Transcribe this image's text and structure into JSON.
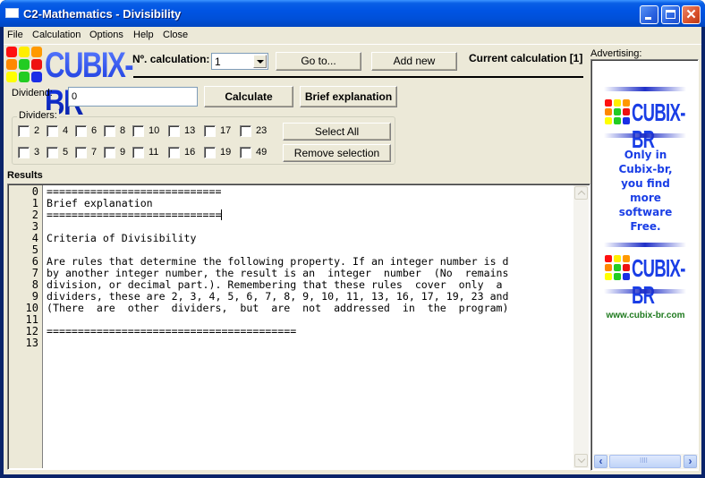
{
  "window": {
    "title": "C2-Mathematics - Divisibility",
    "controls": {
      "minimize": "minimize",
      "maximize": "maximize",
      "close": "✕"
    }
  },
  "menu": [
    "File",
    "Calculation",
    "Options",
    "Help",
    "Close"
  ],
  "logo": {
    "text": "CUBIX-BR",
    "colors": [
      "#ff1010",
      "#ffee00",
      "#ff9900",
      "#ff8800",
      "#22cc22",
      "#ee1111",
      "#ffff00",
      "#22cc22",
      "#1a2ee6"
    ]
  },
  "toolbar": {
    "calc_number_label": "Nº. calculation:",
    "calc_number_value": "1",
    "goto_label": "Go to...",
    "add_new_label": "Add new",
    "current_calc_label": "Current calculation [1]"
  },
  "dividend": {
    "label": "Dividend:",
    "value": "0"
  },
  "actions": {
    "calculate": "Calculate",
    "brief_explanation": "Brief explanation"
  },
  "dividers": {
    "title": "Dividers:",
    "row1": [
      {
        "label": "2",
        "checked": false
      },
      {
        "label": "4",
        "checked": false
      },
      {
        "label": "6",
        "checked": false
      },
      {
        "label": "8",
        "checked": false
      },
      {
        "label": "10",
        "checked": false
      },
      {
        "label": "13",
        "checked": false
      },
      {
        "label": "17",
        "checked": false
      },
      {
        "label": "23",
        "checked": false
      }
    ],
    "row2": [
      {
        "label": "3",
        "checked": false
      },
      {
        "label": "5",
        "checked": false
      },
      {
        "label": "7",
        "checked": false
      },
      {
        "label": "9",
        "checked": false
      },
      {
        "label": "11",
        "checked": false
      },
      {
        "label": "16",
        "checked": false
      },
      {
        "label": "19",
        "checked": false
      },
      {
        "label": "49",
        "checked": false
      }
    ],
    "select_all": "Select All",
    "remove_selection": "Remove selection"
  },
  "results": {
    "label": "Results",
    "lines": [
      "============================",
      "Brief explanation",
      "============================",
      "",
      "Criteria of Divisibility",
      "",
      "Are rules that determine the following property. If an integer number is d",
      "by another integer number, the result is an  integer  number  (No  remains",
      "division, or decimal part.). Remembering that these rules  cover  only  a ",
      "dividers, these are 2, 3, 4, 5, 6, 7, 8, 9, 10, 11, 13, 16, 17, 19, 23 and",
      "(There  are  other  dividers,  but  are  not  addressed  in  the  program)",
      "",
      "========================================",
      ""
    ]
  },
  "advertising": {
    "label": "Advertising:",
    "logo_text": "CUBIX-BR",
    "slogan": [
      "Only in",
      "Cubix-br,",
      "you find",
      "more",
      "software",
      "Free."
    ],
    "url": "www.cubix-br.com"
  }
}
